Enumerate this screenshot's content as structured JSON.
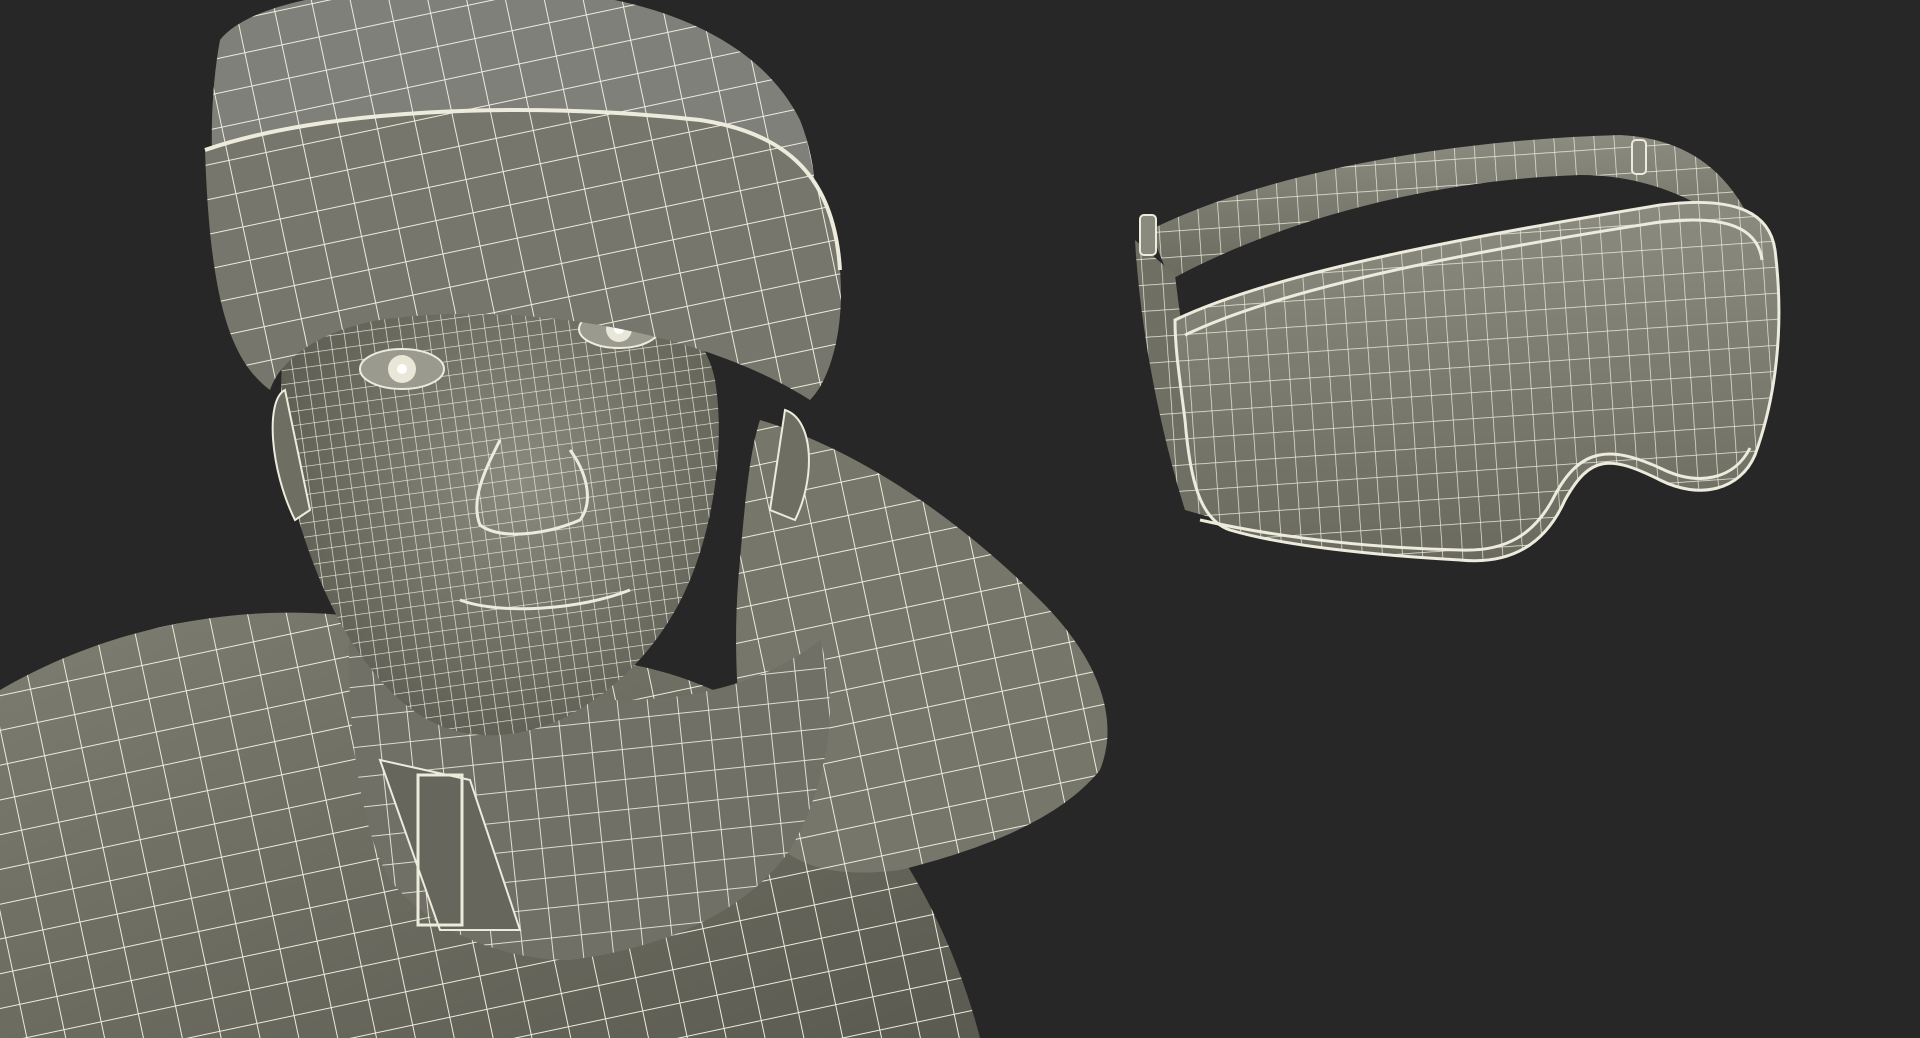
{
  "scene": {
    "background_color": "#272727",
    "mesh_fill": "#7f7f73",
    "mesh_shade": "#5c5c52",
    "wire_color": "#ecebdc",
    "objects": [
      {
        "name": "character-bust",
        "description_icon": "wireframe-head-icon"
      },
      {
        "name": "ski-goggles",
        "description_icon": "wireframe-goggles-icon"
      }
    ]
  }
}
